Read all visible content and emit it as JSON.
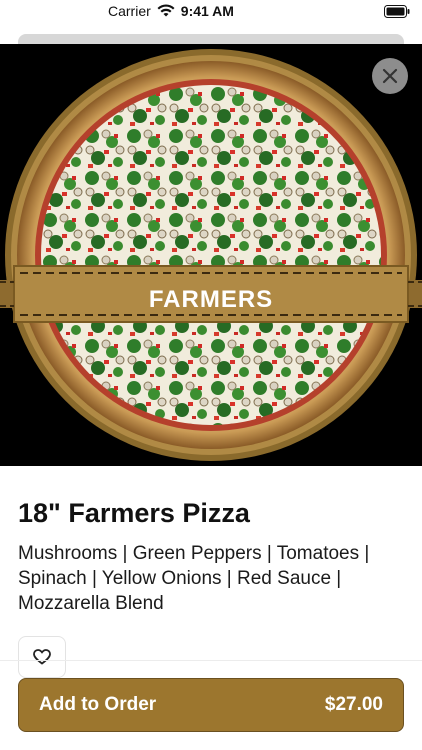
{
  "status_bar": {
    "carrier": "Carrier",
    "time": "9:41 AM"
  },
  "hero": {
    "banner_text": "FARMERS",
    "colors": {
      "crust_ring": "#8a6a2c",
      "banner": "#b08a45",
      "background": "#000000"
    }
  },
  "product": {
    "title": "18\" Farmers Pizza",
    "description": "Mushrooms | Green Peppers | Tomatoes | Spinach | Yellow Onions | Red Sauce | Mozzarella Blend"
  },
  "actions": {
    "close_icon": "close-icon",
    "favorite_icon": "heart-outline-icon",
    "order_label": "Add to Order",
    "order_price": "$27.00",
    "accent_color": "#9c762e"
  }
}
